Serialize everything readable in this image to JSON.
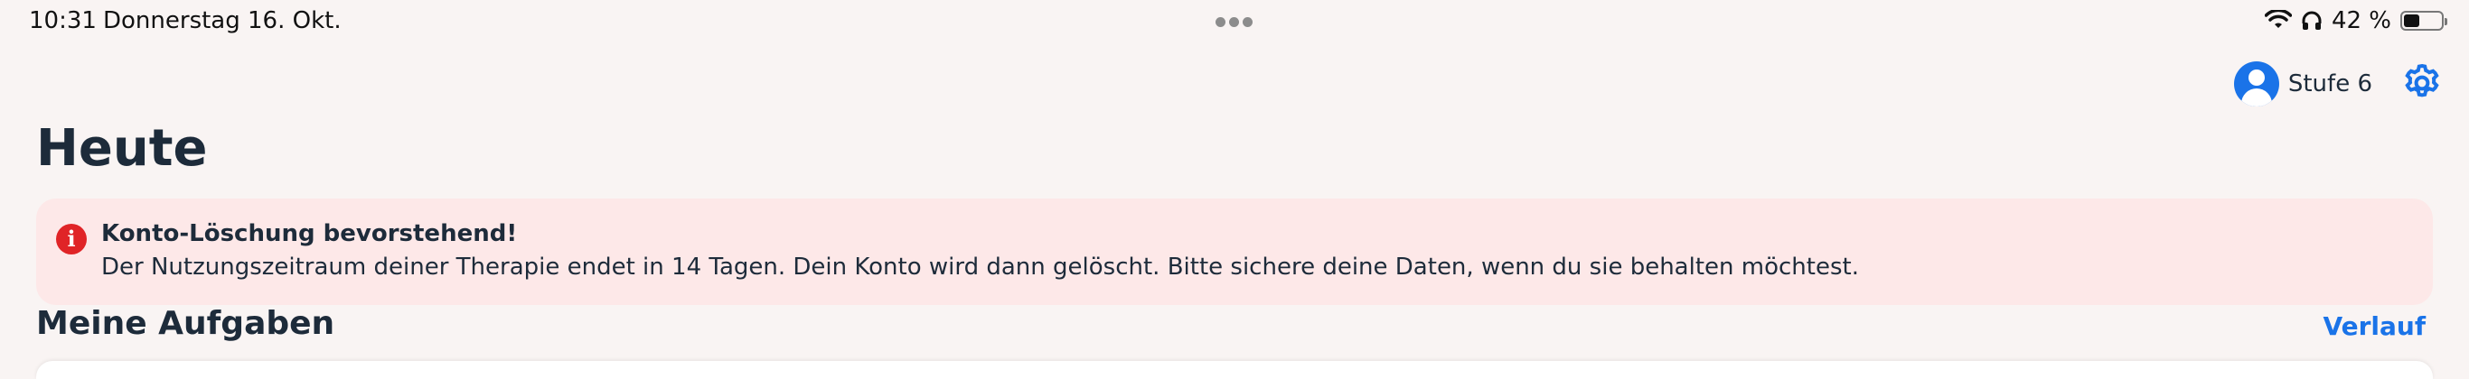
{
  "status_bar": {
    "time": "10:31",
    "date": "Donnerstag 16. Okt.",
    "battery_percent": "42 %",
    "battery_level": 0.42
  },
  "header": {
    "profile_label": "Stufe 6"
  },
  "page": {
    "title": "Heute"
  },
  "alert": {
    "title": "Konto-Löschung bevorstehend!",
    "text": "Der Nutzungszeitraum deiner Therapie endet in 14 Tagen. Dein Konto wird dann gelöscht. Bitte sichere deine Daten, wenn du sie behalten möchtest.",
    "icon_glyph": "i"
  },
  "tasks_section": {
    "title": "Meine Aufgaben",
    "history_link": "Verlauf"
  },
  "colors": {
    "accent": "#1a73e8",
    "alert_background": "#fde8e8",
    "alert_icon": "#e02427",
    "background": "#f9f4f3"
  }
}
